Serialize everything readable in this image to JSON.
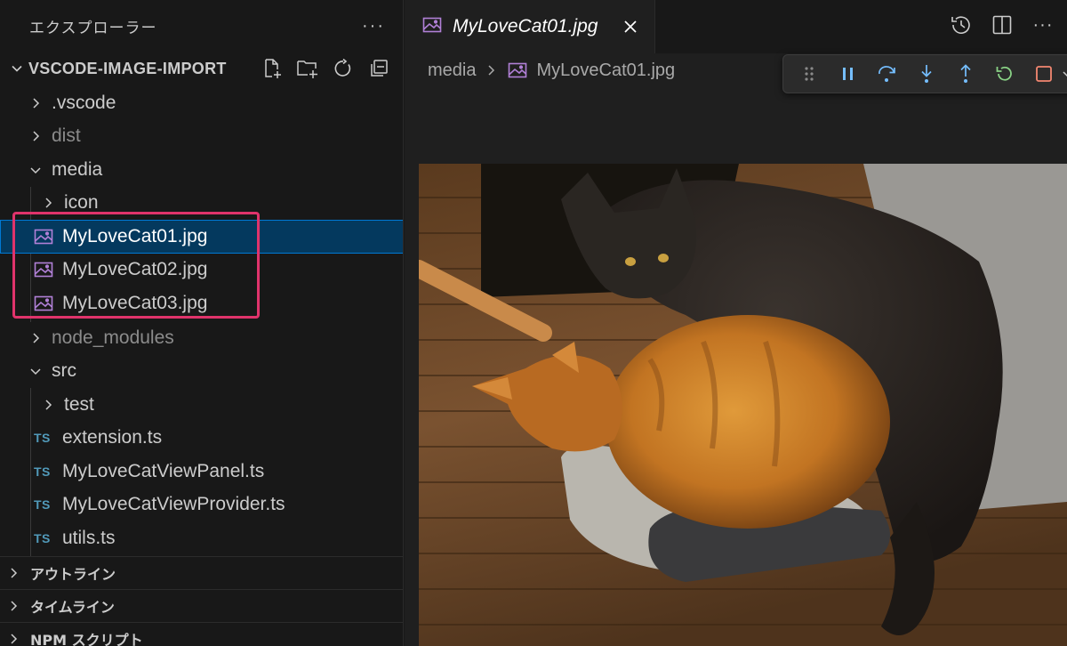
{
  "sidebar": {
    "title": "エクスプローラー",
    "more_label": "···",
    "project": {
      "name": "VSCODE-IMAGE-IMPORT",
      "actions": [
        "new-file-icon",
        "new-folder-icon",
        "refresh-icon",
        "collapse-all-icon"
      ]
    },
    "tree": [
      {
        "label": ".vscode",
        "kind": "folder",
        "expanded": false,
        "depth": 1
      },
      {
        "label": "dist",
        "kind": "folder",
        "expanded": false,
        "depth": 1,
        "dimmed": true
      },
      {
        "label": "media",
        "kind": "folder",
        "expanded": true,
        "depth": 1
      },
      {
        "label": "icon",
        "kind": "folder",
        "expanded": false,
        "depth": 2
      },
      {
        "label": "MyLoveCat01.jpg",
        "kind": "image",
        "depth": 2,
        "selected": true
      },
      {
        "label": "MyLoveCat02.jpg",
        "kind": "image",
        "depth": 2
      },
      {
        "label": "MyLoveCat03.jpg",
        "kind": "image",
        "depth": 2
      },
      {
        "label": "node_modules",
        "kind": "folder",
        "expanded": false,
        "depth": 1,
        "dimmed": true
      },
      {
        "label": "src",
        "kind": "folder",
        "expanded": true,
        "depth": 1
      },
      {
        "label": "test",
        "kind": "folder",
        "expanded": false,
        "depth": 2
      },
      {
        "label": "extension.ts",
        "kind": "ts",
        "depth": 2,
        "badge": "TS"
      },
      {
        "label": "MyLoveCatViewPanel.ts",
        "kind": "ts",
        "depth": 2,
        "badge": "TS"
      },
      {
        "label": "MyLoveCatViewProvider.ts",
        "kind": "ts",
        "depth": 2,
        "badge": "TS"
      },
      {
        "label": "utils.ts",
        "kind": "ts",
        "depth": 2,
        "badge": "TS"
      }
    ],
    "sections": [
      "アウトライン",
      "タイムライン",
      "NPM スクリプト"
    ]
  },
  "editor": {
    "tab": {
      "title": "MyLoveCat01.jpg"
    },
    "breadcrumb": {
      "folder": "media",
      "file": "MyLoveCat01.jpg"
    },
    "actions": [
      "history-icon",
      "split-editor-icon",
      "more-icon"
    ],
    "actions_more_label": "···",
    "debug_toolbar": [
      "drag-handle-icon",
      "pause-icon",
      "step-over-icon",
      "step-into-icon",
      "step-out-icon",
      "restart-icon",
      "stop-icon",
      "chevron-down-icon"
    ]
  },
  "colors": {
    "accent": "#0078d4",
    "selection": "#04395e",
    "highlight": "#e0336b",
    "ts_badge": "#519aba",
    "image_icon": "#b180d7"
  }
}
